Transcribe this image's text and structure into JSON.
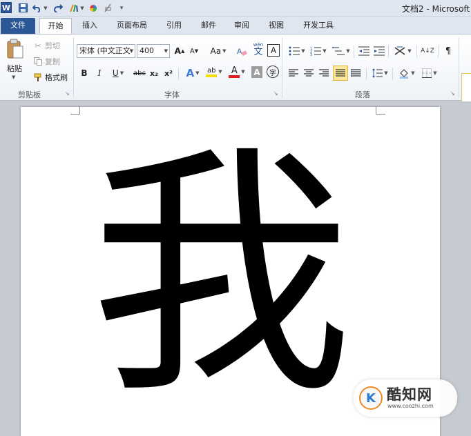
{
  "window": {
    "title": "文档2 - Microsoft"
  },
  "quick_access": {
    "logo_letter": "W"
  },
  "tabs": [
    "文件",
    "开始",
    "插入",
    "页面布局",
    "引用",
    "邮件",
    "审阅",
    "视图",
    "开发工具"
  ],
  "clipboard": {
    "paste": "粘贴",
    "cut": "剪切",
    "copy": "复制",
    "format_painter": "格式刷",
    "label": "剪贴板"
  },
  "font": {
    "font_name": "宋体 (中文正文",
    "font_size": "400",
    "grow": "A",
    "shrink": "A",
    "change_case": "Aa",
    "clear_format": "A",
    "pinyin": "wén",
    "char_border": "A",
    "bold": "B",
    "italic": "I",
    "underline": "U",
    "strike": "abc",
    "subscript": "x₂",
    "superscript": "x²",
    "text_effect": "A",
    "highlight": "ab",
    "font_color": "A",
    "char_shading": "A",
    "enclose": "字",
    "label": "字体"
  },
  "paragraph": {
    "label": "段落",
    "sort": "A↓Z",
    "show_marks": "¶"
  },
  "document": {
    "text": "我"
  },
  "watermark": {
    "logo": "K",
    "name": "酷知网",
    "url": "www.coozhi.com"
  },
  "colors": {
    "file_tab": "#2b5797",
    "highlight": "#f7e000",
    "font_color": "#e01e1e",
    "text_effect": "#3a7bd5",
    "watermark_orange": "#f08a24"
  }
}
